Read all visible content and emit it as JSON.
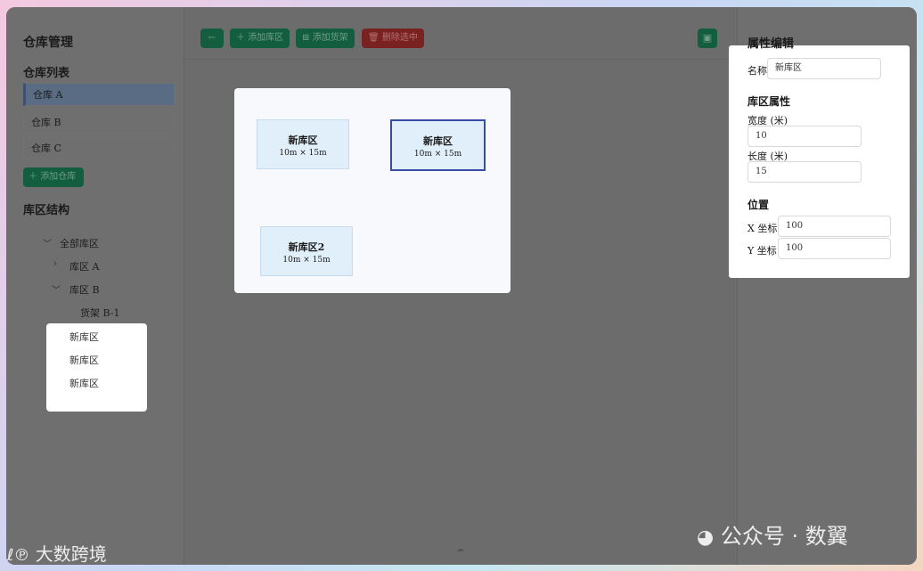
{
  "sidebar": {
    "title": "仓库管理",
    "warehouse_list_title": "仓库列表",
    "warehouses": [
      {
        "label": "仓库 A"
      },
      {
        "label": "仓库 B"
      },
      {
        "label": "仓库 C"
      }
    ],
    "add_warehouse": "添加仓库",
    "structure_title": "库区结构",
    "tree": {
      "root": "全部库区",
      "zone_a": "库区 A",
      "zone_b": "库区 B",
      "shelf_b1": "货架 B-1"
    },
    "popup_items": [
      "新库区",
      "新库区",
      "新库区"
    ]
  },
  "toolbar": {
    "back_icon": "arrow-left-icon",
    "add_zone": "添加库区",
    "add_shelf": "添加货架",
    "delete_selected": "删除选中",
    "save_icon": "save-icon",
    "accent_green": "#145e40",
    "danger_red": "#7a2222"
  },
  "canvas": {
    "zones": [
      {
        "name": "新库区",
        "dims": "10m × 15m",
        "selected": false
      },
      {
        "name": "新库区",
        "dims": "10m × 15m",
        "selected": true
      },
      {
        "name": "新库区2",
        "dims": "10m × 15m",
        "selected": false
      }
    ]
  },
  "properties": {
    "title": "属性编辑",
    "name_label": "名称",
    "name_value": "新库区",
    "zone_attrs_title": "库区属性",
    "width_label": "宽度 (米)",
    "width_value": "10",
    "length_label": "长度 (米)",
    "length_value": "15",
    "position_title": "位置",
    "x_label": "X 坐标",
    "x_value": "100",
    "y_label": "Y 坐标",
    "y_value": "100"
  },
  "watermark": {
    "left_text": "大数跨境",
    "right_text": "公众号 · 数翼"
  }
}
